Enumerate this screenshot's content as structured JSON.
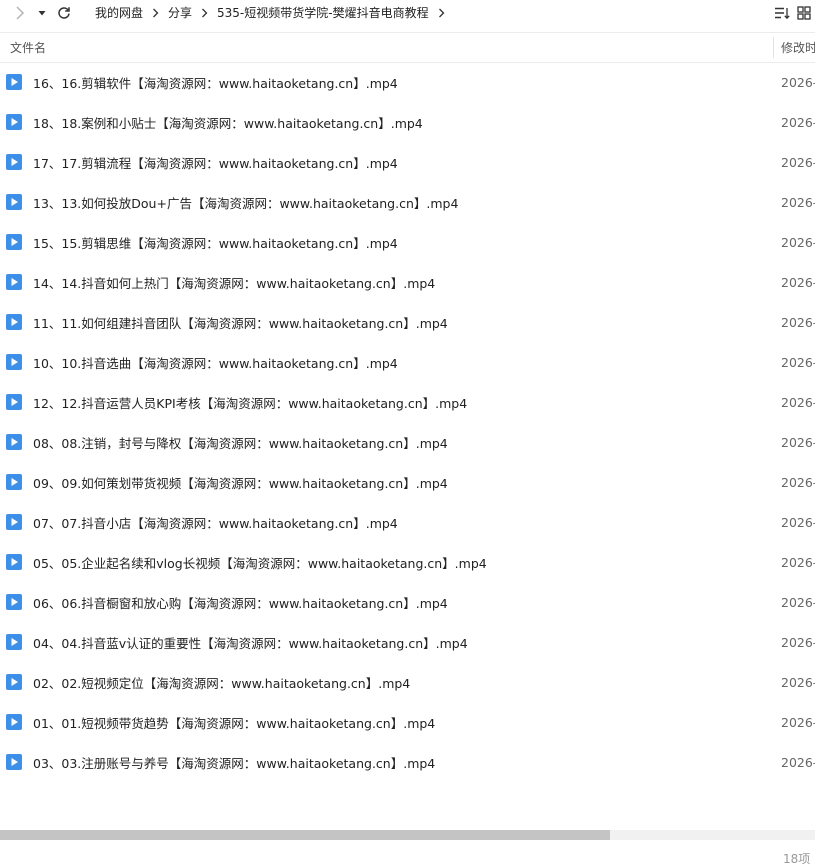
{
  "breadcrumb": {
    "items": [
      "我的网盘",
      "分享",
      "535-短视频带货学院-樊燿抖音电商教程"
    ]
  },
  "columns": {
    "name": "文件名",
    "modified": "修改时"
  },
  "files": [
    {
      "name": "16、16.剪辑软件【海淘资源网：www.haitaoketang.cn】.mp4",
      "date": "2026-"
    },
    {
      "name": "18、18.案例和小贴士【海淘资源网：www.haitaoketang.cn】.mp4",
      "date": "2026-"
    },
    {
      "name": "17、17.剪辑流程【海淘资源网：www.haitaoketang.cn】.mp4",
      "date": "2026-"
    },
    {
      "name": "13、13.如何投放Dou+广告【海淘资源网：www.haitaoketang.cn】.mp4",
      "date": "2026-"
    },
    {
      "name": "15、15.剪辑思维【海淘资源网：www.haitaoketang.cn】.mp4",
      "date": "2026-"
    },
    {
      "name": "14、14.抖音如何上热门【海淘资源网：www.haitaoketang.cn】.mp4",
      "date": "2026-"
    },
    {
      "name": "11、11.如何组建抖音团队【海淘资源网：www.haitaoketang.cn】.mp4",
      "date": "2026-"
    },
    {
      "name": "10、10.抖音选曲【海淘资源网：www.haitaoketang.cn】.mp4",
      "date": "2026-"
    },
    {
      "name": "12、12.抖音运营人员KPI考核【海淘资源网：www.haitaoketang.cn】.mp4",
      "date": "2026-"
    },
    {
      "name": "08、08.注销，封号与降权【海淘资源网：www.haitaoketang.cn】.mp4",
      "date": "2026-"
    },
    {
      "name": "09、09.如何策划带货视频【海淘资源网：www.haitaoketang.cn】.mp4",
      "date": "2026-"
    },
    {
      "name": "07、07.抖音小店【海淘资源网：www.haitaoketang.cn】.mp4",
      "date": "2026-"
    },
    {
      "name": "05、05.企业起名续和vlog长视频【海淘资源网：www.haitaoketang.cn】.mp4",
      "date": "2026-"
    },
    {
      "name": "06、06.抖音橱窗和放心购【海淘资源网：www.haitaoketang.cn】.mp4",
      "date": "2026-"
    },
    {
      "name": "04、04.抖音蓝v认证的重要性【海淘资源网：www.haitaoketang.cn】.mp4",
      "date": "2026-"
    },
    {
      "name": "02、02.短视频定位【海淘资源网：www.haitaoketang.cn】.mp4",
      "date": "2026-"
    },
    {
      "name": "01、01.短视频带货趋势【海淘资源网：www.haitaoketang.cn】.mp4",
      "date": "2026-"
    },
    {
      "name": "03、03.注册账号与养号【海淘资源网：www.haitaoketang.cn】.mp4",
      "date": "2026-"
    }
  ],
  "status": {
    "count": "18项"
  },
  "icons": {
    "forward": "chevron-right-icon",
    "dropdown": "caret-down-icon",
    "refresh": "refresh-icon",
    "sort": "sort-list-icon",
    "grid": "grid-view-icon",
    "video": "video-file-icon"
  },
  "colors": {
    "video_icon": "#3d8fe8",
    "scroll_thumb": "#c4c4c4"
  }
}
